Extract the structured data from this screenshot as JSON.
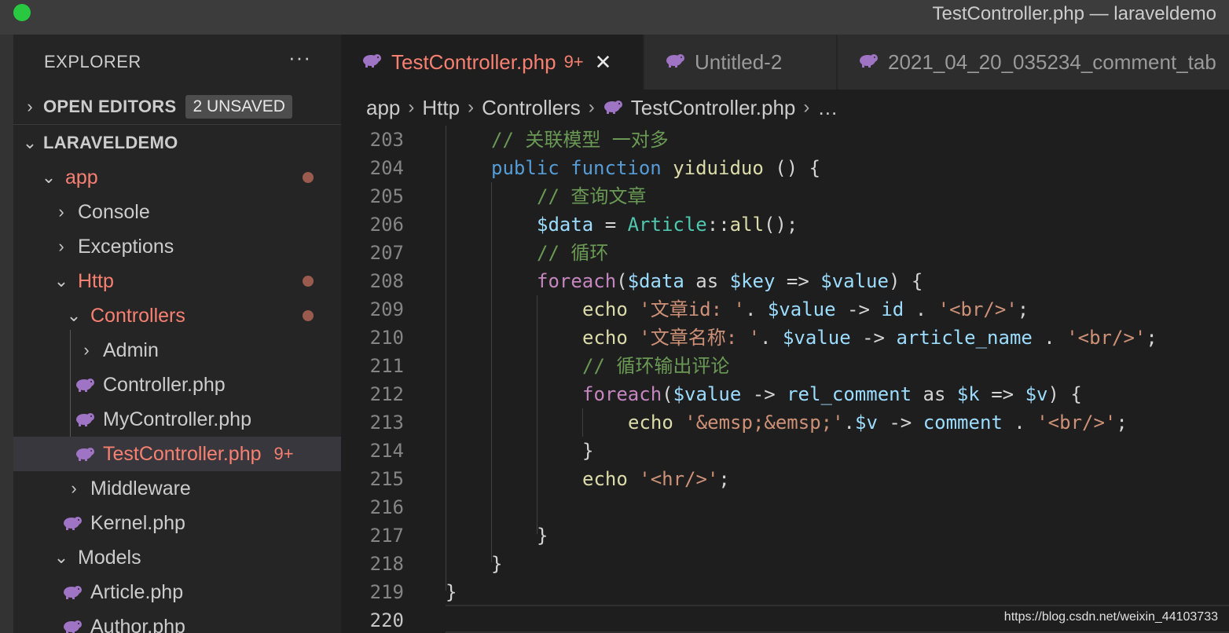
{
  "window": {
    "title": "TestController.php — laraveldemo"
  },
  "colors": {
    "accent_modified": "#f88070",
    "php_icon": "#a074c4",
    "traffic_light": "#28c940"
  },
  "sidebar": {
    "header": "EXPLORER",
    "more": "···",
    "open_editors": {
      "label": "OPEN EDITORS",
      "badge": "2 UNSAVED"
    },
    "project": "LARAVELDEMO",
    "tree": [
      {
        "label": "app",
        "modified": true
      },
      {
        "label": "Console",
        "modified": false
      },
      {
        "label": "Exceptions",
        "modified": false
      },
      {
        "label": "Http",
        "modified": true
      },
      {
        "label": "Controllers",
        "modified": true
      },
      {
        "label": "Admin",
        "modified": false
      },
      {
        "label": "Controller.php",
        "modified": false
      },
      {
        "label": "MyController.php",
        "modified": false
      },
      {
        "label": "TestController.php",
        "modified": true,
        "count": "9+",
        "selected": true
      },
      {
        "label": "Middleware",
        "modified": false
      },
      {
        "label": "Kernel.php",
        "modified": false
      },
      {
        "label": "Models",
        "modified": false
      },
      {
        "label": "Article.php",
        "modified": false
      },
      {
        "label": "Author.php",
        "modified": false
      }
    ]
  },
  "tabs": [
    {
      "title": "TestController.php",
      "count": "9+",
      "close": "✕",
      "active": true
    },
    {
      "title": "Untitled-2",
      "active": false
    },
    {
      "title": "2021_04_20_035234_comment_tab",
      "active": false
    }
  ],
  "breadcrumb": {
    "items": [
      "app",
      "Http",
      "Controllers",
      "TestController.php"
    ],
    "sep": "›",
    "ellipsis": "…"
  },
  "editor": {
    "line_numbers": [
      "203",
      "204",
      "205",
      "206",
      "207",
      "208",
      "209",
      "210",
      "211",
      "212",
      "213",
      "214",
      "215",
      "216",
      "217",
      "218",
      "219",
      "220"
    ],
    "tokens": {
      "l203_c": "// 关联模型 一对多",
      "l204_kw1": "public",
      "l204_kw2": "function",
      "l204_fn": "yiduiduo",
      "l204_p": " () {",
      "l205_c": "// 查询文章",
      "l206_v": "$data",
      "l206_op": " = ",
      "l206_cls": "Article",
      "l206_sep": "::",
      "l206_fn": "all",
      "l206_p": "();",
      "l207_c": "// 循环",
      "l208_kw": "foreach",
      "l208_p1": "(",
      "l208_v1": "$data",
      "l208_as": " as ",
      "l208_v2": "$key",
      "l208_arr": " => ",
      "l208_v3": "$value",
      "l208_p2": ") {",
      "l209_fn": "echo",
      "l209_s1": " '文章id: '",
      "l209_dot1": ". ",
      "l209_v": "$value",
      "l209_arr": " -> ",
      "l209_prop": "id",
      "l209_dot2": " . ",
      "l209_s2": "'<br/>'",
      "l209_semi": ";",
      "l210_fn": "echo",
      "l210_s1": " '文章名称: '",
      "l210_dot1": ". ",
      "l210_v": "$value",
      "l210_arr": " -> ",
      "l210_prop": "article_name",
      "l210_dot2": " . ",
      "l210_s2": "'<br/>'",
      "l210_semi": ";",
      "l211_c": "// 循环输出评论",
      "l212_kw": "foreach",
      "l212_p1": "(",
      "l212_v1": "$value",
      "l212_arr": " -> ",
      "l212_prop": "rel_comment",
      "l212_as": " as ",
      "l212_v2": "$k",
      "l212_arr2": " => ",
      "l212_v3": "$v",
      "l212_p2": ") {",
      "l213_fn": "echo",
      "l213_s1": " '&emsp;&emsp;'",
      "l213_dot1": ".",
      "l213_v": "$v",
      "l213_arr": " -> ",
      "l213_prop": "comment",
      "l213_dot2": " . ",
      "l213_s2": "'<br/>'",
      "l213_semi": ";",
      "l214_p": "}",
      "l215_fn": "echo",
      "l215_s": " '<hr/>'",
      "l215_semi": ";",
      "l217_p": "}",
      "l218_p": "}",
      "l219_p": "}"
    }
  },
  "watermark": "https://blog.csdn.net/weixin_44103733"
}
